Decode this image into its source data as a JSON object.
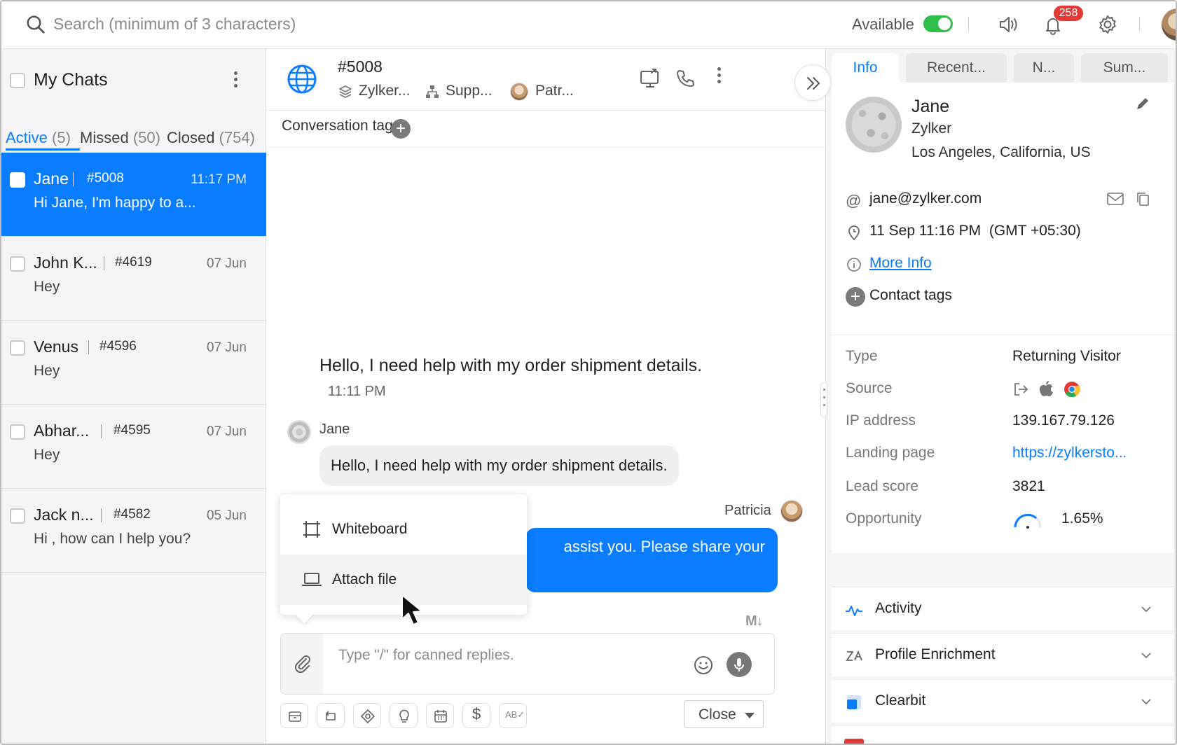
{
  "topbar": {
    "search_placeholder": "Search (minimum of 3 characters)",
    "availability_label": "Available",
    "notification_count": "258"
  },
  "left_panel": {
    "title": "My Chats",
    "tabs": [
      {
        "label": "Active",
        "count": "(5)"
      },
      {
        "label": "Missed",
        "count": "(50)"
      },
      {
        "label": "Closed",
        "count": "(754)"
      }
    ],
    "chats": [
      {
        "name": "Jane",
        "id": "#5008",
        "time": "11:17 PM",
        "preview": "Hi Jane, I'm happy to a..."
      },
      {
        "name": "John K...",
        "id": "#4619",
        "time": "07 Jun",
        "preview": "Hey"
      },
      {
        "name": "Venus",
        "id": "#4596",
        "time": "07 Jun",
        "preview": "Hey"
      },
      {
        "name": "Abhar...",
        "id": "#4595",
        "time": "07 Jun",
        "preview": "Hey"
      },
      {
        "name": "Jack n...",
        "id": "#4582",
        "time": "05 Jun",
        "preview": "Hi , how can I help you?"
      }
    ]
  },
  "conversation": {
    "id": "#5008",
    "brand": "Zylker...",
    "department": "Supp...",
    "agent": "Patr...",
    "tags_label": "Conversation tags",
    "system_message": "Hello, I need help with my order shipment details.",
    "system_time": "11:11 PM",
    "visitor_name": "Jane",
    "visitor_message": "Hello, I need help with my order shipment details.",
    "operator_name": "Patricia",
    "operator_message_visible": "assist you. Please share your",
    "attach_menu": {
      "whiteboard": "Whiteboard",
      "attach_file": "Attach file"
    },
    "composer_placeholder": "Type \"/\" for canned replies.",
    "close_label": "Close"
  },
  "right_panel": {
    "tabs": [
      "Info",
      "Recent...",
      "N...",
      "Sum..."
    ],
    "contact": {
      "name": "Jane",
      "company": "Zylker",
      "location": "Los Angeles, California, US",
      "email": "jane@zylker.com",
      "local_time": "11 Sep 11:16 PM",
      "timezone": "(GMT +05:30)",
      "more_info": "More Info",
      "contact_tags": "Contact tags"
    },
    "properties": [
      {
        "key": "Type",
        "value": "Returning Visitor"
      },
      {
        "key": "Source",
        "value": ""
      },
      {
        "key": "IP address",
        "value": "139.167.79.126"
      },
      {
        "key": "Landing page",
        "value": "https://zylkersto..."
      },
      {
        "key": "Lead score",
        "value": "3821"
      },
      {
        "key": "Opportunity",
        "value": "1.65%"
      }
    ],
    "sections": [
      "Activity",
      "Profile Enrichment",
      "Clearbit"
    ]
  },
  "colors": {
    "accent": "#0a7cff",
    "available_green": "#2fbf4a",
    "badge_red": "#e53935"
  }
}
